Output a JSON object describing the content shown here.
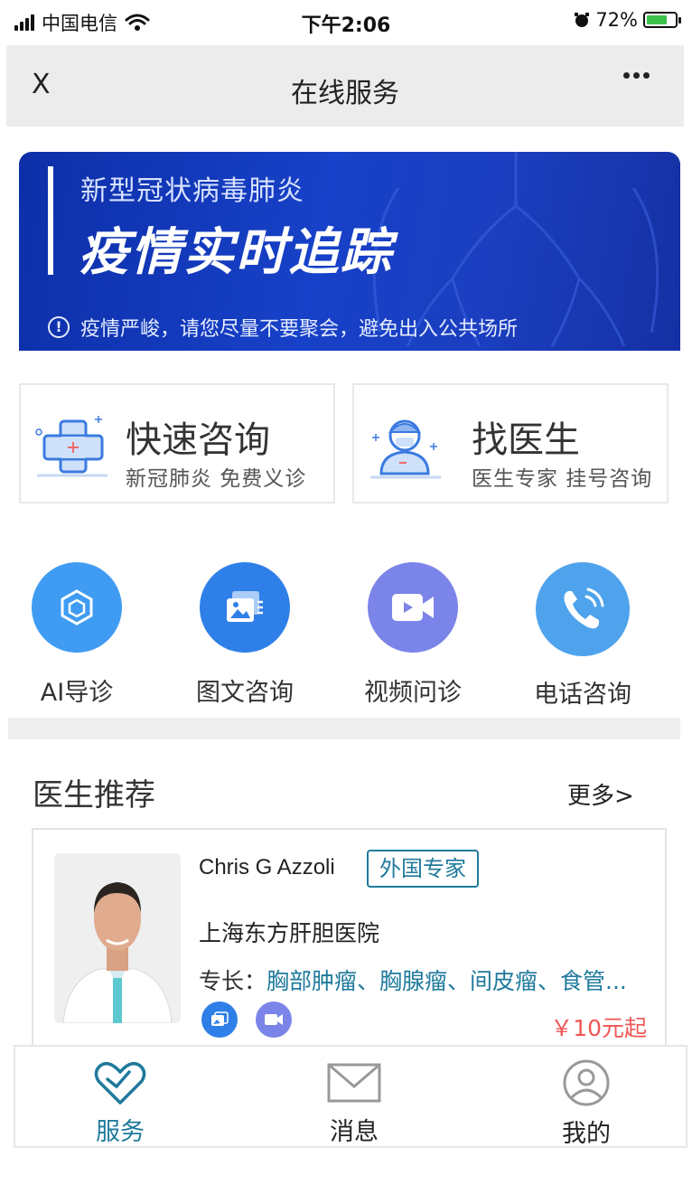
{
  "status_bar": {
    "carrier": "中国电信",
    "time": "下午2:06",
    "battery": "72%",
    "battery_level": 0.72
  },
  "header": {
    "close_label": "X",
    "title": "在线服务"
  },
  "banner": {
    "subtitle": "新型冠状病毒肺炎",
    "title": "疫情实时追踪",
    "notice": "疫情严峻，请您尽量不要聚会，避免出入公共场所",
    "notice_icon": "!"
  },
  "quick_cards": [
    {
      "title": "快速咨询",
      "subtitle": "新冠肺炎  免费义诊",
      "icon": "medical-cross-icon"
    },
    {
      "title": "找医生",
      "subtitle": "医生专家  挂号咨询",
      "icon": "doctor-icon"
    }
  ],
  "services": [
    {
      "label": "AI导诊",
      "icon": "cube-icon",
      "color": "#3f9cf2"
    },
    {
      "label": "图文咨询",
      "icon": "image-text-icon",
      "color": "#2f7fe8"
    },
    {
      "label": "视频问诊",
      "icon": "video-icon",
      "color": "#7b84e8"
    },
    {
      "label": "电话咨询",
      "icon": "phone-icon",
      "color": "#4fa3ec"
    }
  ],
  "recommend": {
    "title": "医生推荐",
    "more": "更多>",
    "doctor": {
      "name": "Chris G Azzoli",
      "badge": "外国专家",
      "hospital": "上海东方肝胆医院",
      "specialty_label": "专长：",
      "specialty": "胸部肿瘤、胸腺瘤、间皮瘤、食管...",
      "price": "￥10元起"
    }
  },
  "tabbar": {
    "items": [
      {
        "label": "服务",
        "icon": "heart-icon",
        "active": true
      },
      {
        "label": "消息",
        "icon": "mail-icon",
        "active": false
      },
      {
        "label": "我的",
        "icon": "user-icon",
        "active": false
      }
    ]
  },
  "colors": {
    "accent": "#1f7a9c",
    "price": "#f05555",
    "banner": "#1741c8"
  }
}
